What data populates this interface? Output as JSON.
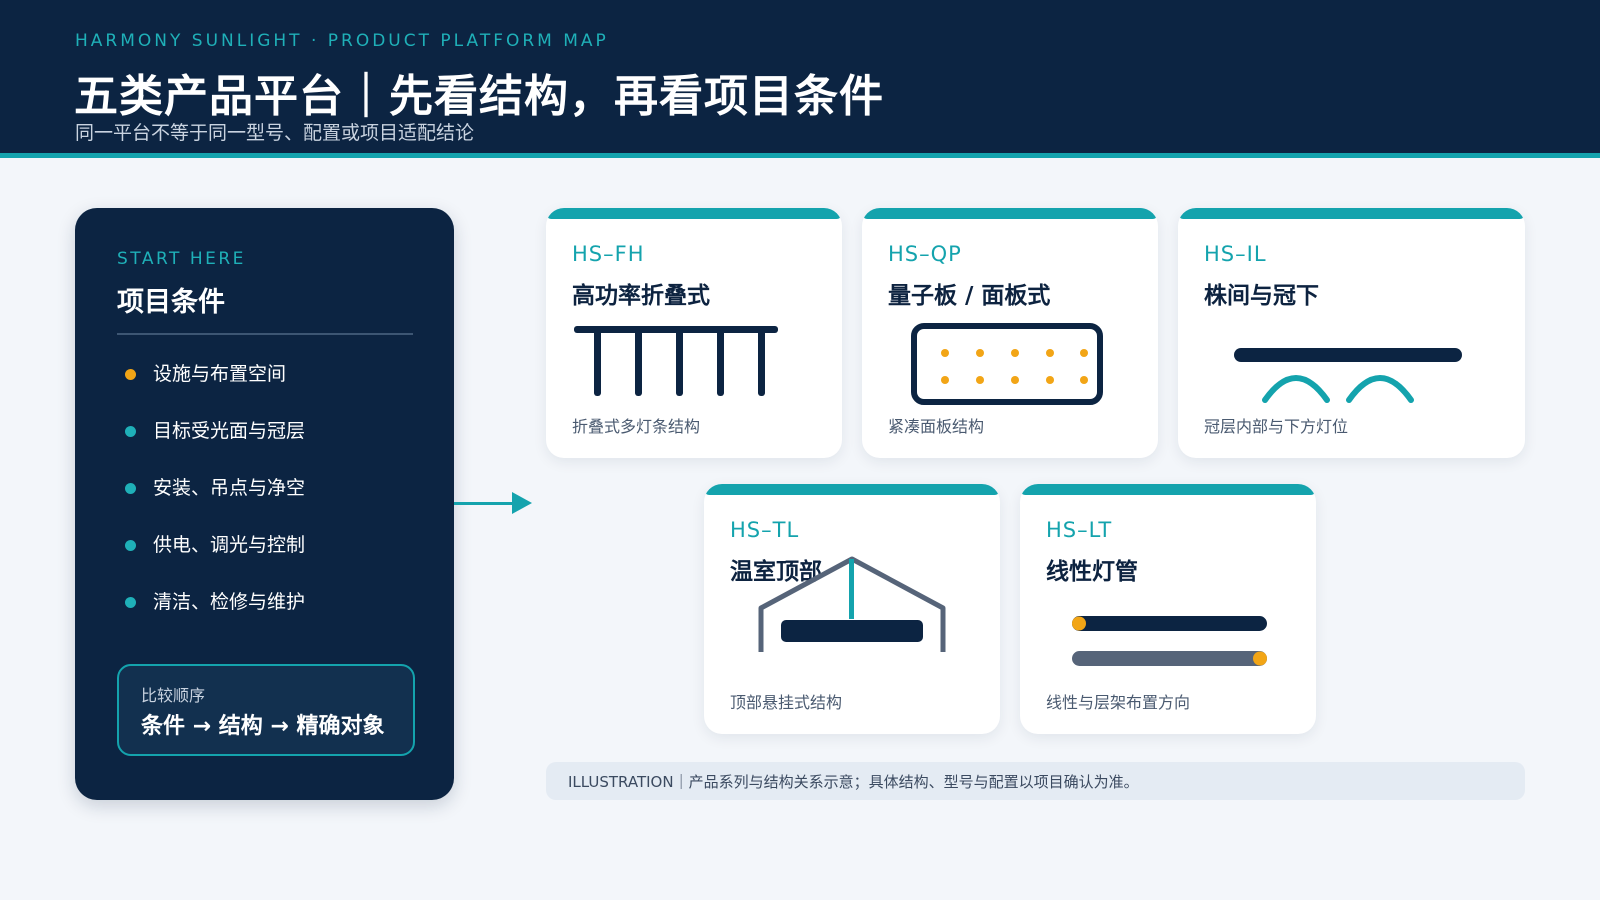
{
  "header": {
    "kicker": "HARMONY SUNLIGHT · PRODUCT PLATFORM MAP",
    "title": "五类产品平台｜先看结构，再看项目条件",
    "subtitle": "同一平台不等于同一型号、配置或项目适配结论"
  },
  "panel": {
    "kicker": "START HERE",
    "title": "项目条件",
    "conditions": [
      "设施与布置空间",
      "目标受光面与冠层",
      "安装、吊点与净空",
      "供电、调光与控制",
      "清洁、检修与维护"
    ],
    "order_label": "比较顺序",
    "order_sequence": "条件 → 结构 → 精确对象"
  },
  "cards": [
    {
      "code": "HS–FH",
      "name": "高功率折叠式",
      "desc": "折叠式多灯条结构",
      "icon": "foldable-bars-icon"
    },
    {
      "code": "HS–QP",
      "name": "量子板 / 面板式",
      "desc": "紧凑面板结构",
      "icon": "quantum-board-icon"
    },
    {
      "code": "HS–IL",
      "name": "株间与冠下",
      "desc": "冠层内部与下方灯位",
      "icon": "interlighting-icon"
    },
    {
      "code": "HS–TL",
      "name": "温室顶部",
      "desc": "顶部悬挂式结构",
      "icon": "greenhouse-toplight-icon"
    },
    {
      "code": "HS–LT",
      "name": "线性灯管",
      "desc": "线性与层架布置方向",
      "icon": "linear-tube-icon"
    }
  ],
  "footnote": "ILLUSTRATION｜产品系列与结构关系示意；具体结构、型号与配置以项目确认为准。",
  "colors": {
    "navy": "#0c2442",
    "teal": "#14a3ad",
    "amber": "#f2a516",
    "slate": "#566479"
  }
}
